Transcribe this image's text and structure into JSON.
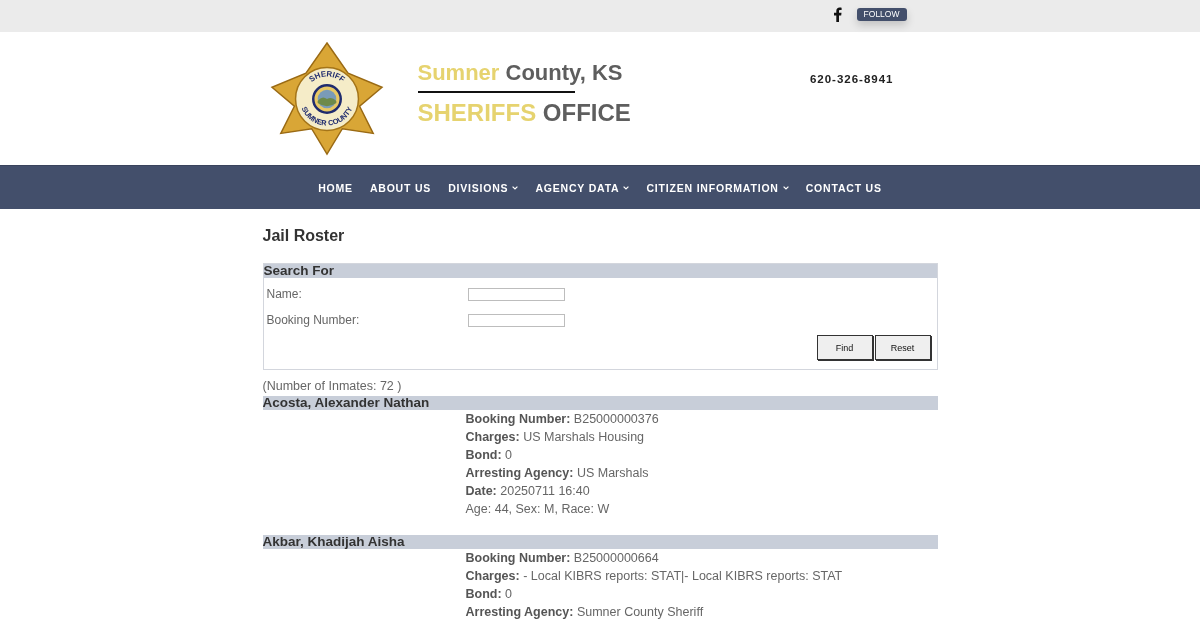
{
  "top_bar": {
    "follow_button": "FOLLOW"
  },
  "header": {
    "logo": {
      "top_text": "SHERIFF",
      "bottom_text": "SUMNER COUNTY"
    },
    "title": {
      "accent": "Sumner",
      "text": "County, KS"
    },
    "subtitle": {
      "accent": "SHERIFFS",
      "text": "OFFICE"
    },
    "phone": "620-326-8941"
  },
  "nav": {
    "items": [
      {
        "label": "HOME",
        "dropdown": false
      },
      {
        "label": "ABOUT US",
        "dropdown": false
      },
      {
        "label": "DIVISIONS",
        "dropdown": true
      },
      {
        "label": "AGENCY DATA",
        "dropdown": true
      },
      {
        "label": "CITIZEN INFORMATION",
        "dropdown": true
      },
      {
        "label": "CONTACT US",
        "dropdown": false
      }
    ]
  },
  "page_title": "Jail Roster",
  "search": {
    "heading": "Search For",
    "fields": [
      {
        "label": "Name:"
      },
      {
        "label": "Booking Number:"
      }
    ],
    "buttons": [
      "Find",
      "Reset"
    ]
  },
  "inmate_count": "(Number of Inmates: 72 )",
  "inmates": [
    {
      "name": "Acosta, Alexander Nathan",
      "details": [
        {
          "label": "Booking Number:",
          "value": "B25000000376"
        },
        {
          "label": "Charges:",
          "value": "US Marshals Housing"
        },
        {
          "label": "Bond:",
          "value": "0"
        },
        {
          "label": "Arresting Agency:",
          "value": "US Marshals"
        },
        {
          "label": "Date:",
          "value": "20250711 16:40"
        }
      ],
      "summary": "Age: 44, Sex: M, Race: W"
    },
    {
      "name": "Akbar, Khadijah Aisha",
      "details": [
        {
          "label": "Booking Number:",
          "value": "B25000000664"
        },
        {
          "label": "Charges:",
          "value": "- Local KIBRS reports: STAT|- Local KIBRS reports: STAT"
        },
        {
          "label": "Bond:",
          "value": "0"
        },
        {
          "label": "Arresting Agency:",
          "value": "Sumner County Sheriff"
        }
      ]
    }
  ]
}
